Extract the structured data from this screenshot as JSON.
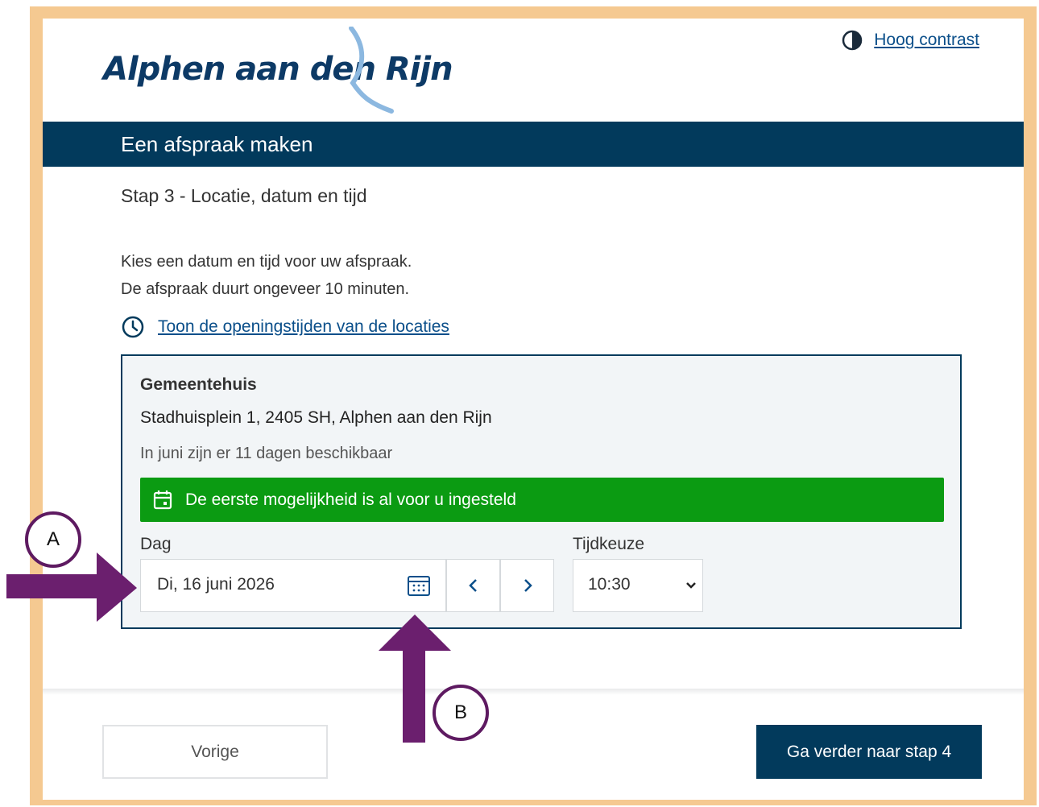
{
  "header": {
    "logo_text": "Alphen aan den Rijn",
    "contrast_link": "Hoog contrast"
  },
  "banner": {
    "title": "Een afspraak maken"
  },
  "step": {
    "title": "Stap 3 - Locatie, datum en tijd"
  },
  "intro": {
    "line1": "Kies een datum en tijd voor uw afspraak.",
    "line2": "De afspraak duurt ongeveer 10 minuten."
  },
  "hours_link": "Toon de openingstijden van de locaties",
  "location": {
    "name": "Gemeentehuis",
    "address": "Stadhuisplein 1, 2405 SH, Alphen aan den Rijn",
    "availability": "In juni zijn er 11 dagen beschikbaar",
    "notice": "De eerste mogelijkheid is al voor u ingesteld",
    "day_label": "Dag",
    "day_value": "Di, 16 juni 2026",
    "time_label": "Tijdkeuze",
    "time_value": "10:30"
  },
  "footer": {
    "prev_label": "Vorige",
    "next_label": "Ga verder naar stap 4"
  },
  "annotations": {
    "marker_a": "A",
    "marker_b": "B"
  },
  "colors": {
    "brand_dark": "#023a5c",
    "success": "#0b9b12",
    "annotation": "#6b1f6e",
    "frame": "#f5c991"
  }
}
